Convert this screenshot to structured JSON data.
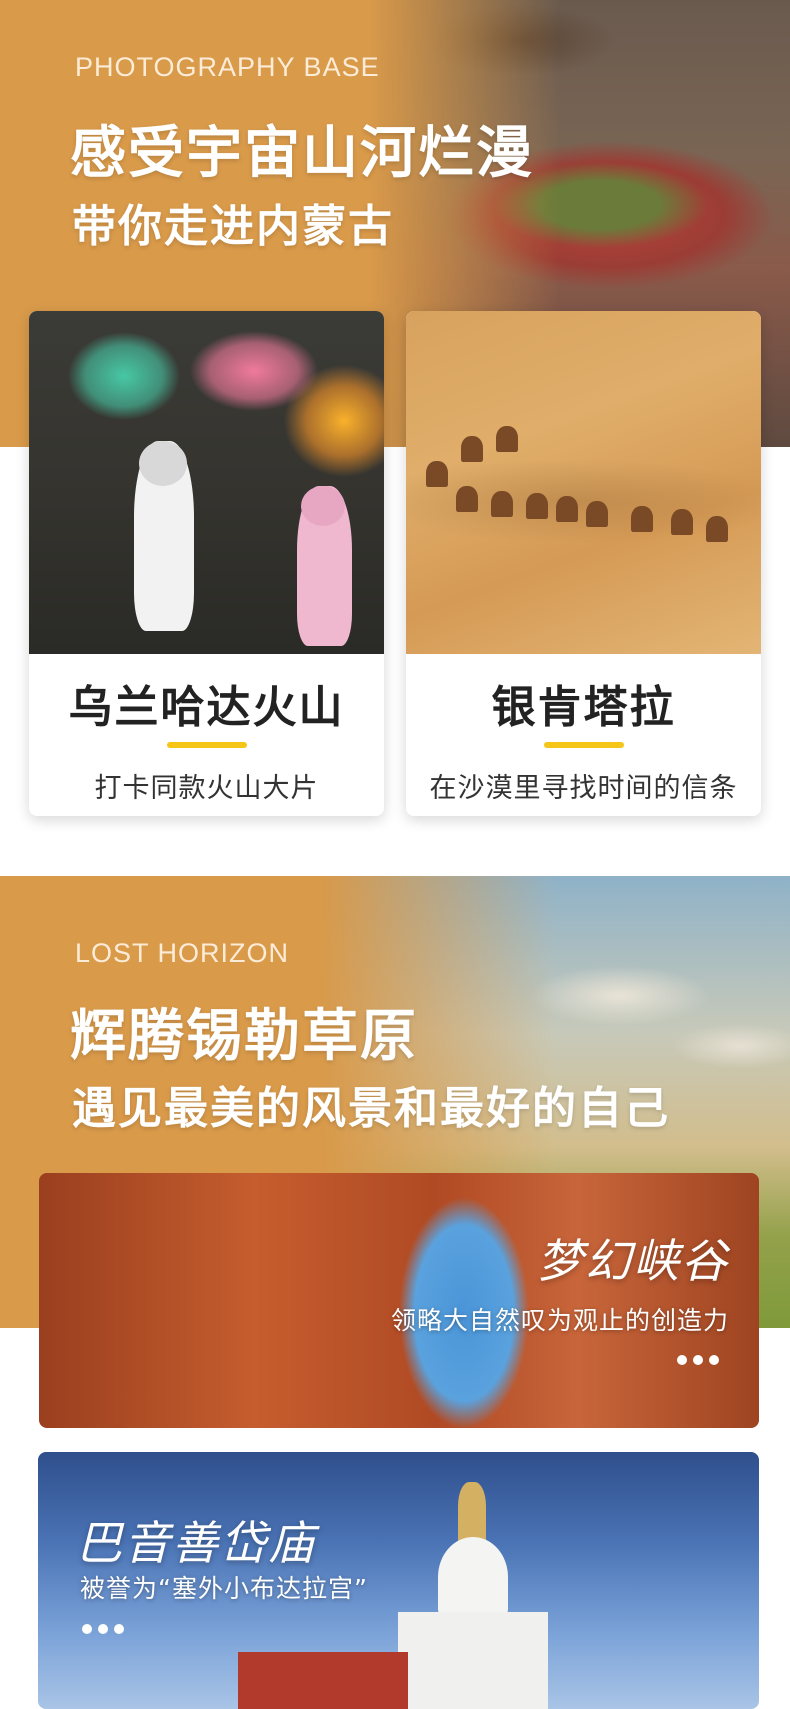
{
  "section1": {
    "eyebrow": "PHOTOGRAPHY BASE",
    "title": "感受宇宙山河烂漫",
    "subtitle": "带你走进内蒙古",
    "cards": [
      {
        "title": "乌兰哈达火山",
        "subtitle": "打卡同款火山大片"
      },
      {
        "title": "银肯塔拉",
        "subtitle": "在沙漠里寻找时间的信条"
      }
    ]
  },
  "section2": {
    "eyebrow": "LOST HORIZON",
    "title": "辉腾锡勒草原",
    "subtitle": "遇见最美的风景和最好的自己",
    "banners": [
      {
        "title": "梦幻峡谷",
        "subtitle": "领略大自然叹为观止的创造力"
      },
      {
        "title": "巴音善岱庙",
        "subtitle": "被誉为“塞外小布达拉宫”"
      }
    ]
  },
  "colors": {
    "section_bg": "#d99a4a",
    "accent_bar": "#f5c518"
  },
  "icons": [
    "more-dots-icon"
  ]
}
